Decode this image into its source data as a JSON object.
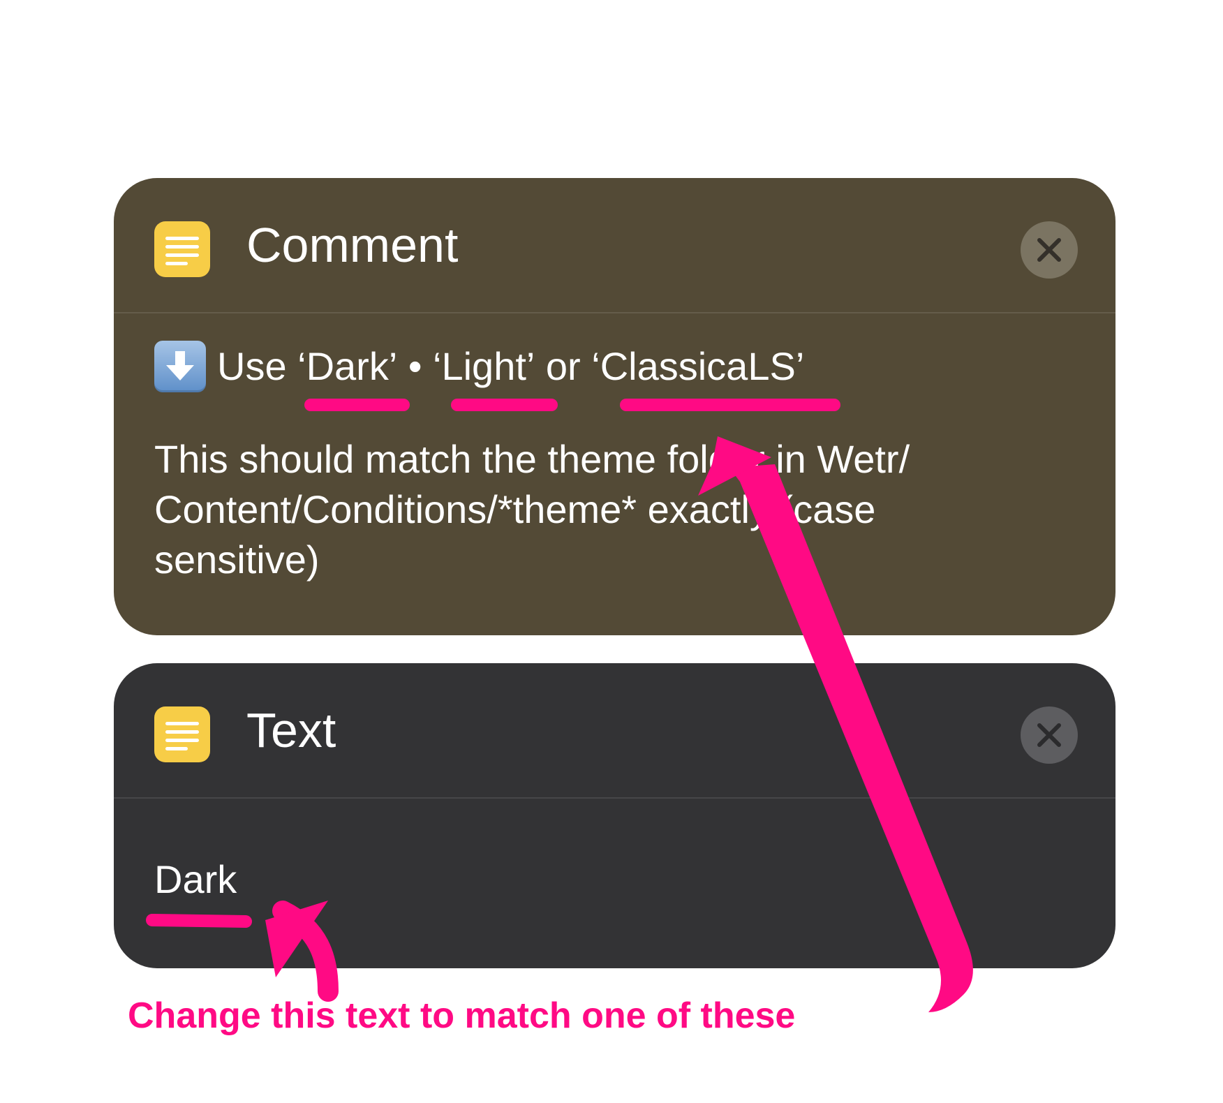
{
  "comment_card": {
    "title": "Comment",
    "line1": {
      "prefix": "Use ",
      "option_dark": "‘Dark’",
      "bullet": " • ",
      "option_light": "‘Light’",
      "or_text": " or ",
      "option_classic": "‘ClassicaLS’"
    },
    "description": "This should match the theme folder in Wetr/ Content/Conditions/*theme* exactly (case sensitive)"
  },
  "text_card": {
    "title": "Text",
    "value": "Dark"
  },
  "annotation": {
    "label": "Change this text to match one of these",
    "color": "#ff0a84"
  },
  "colors": {
    "comment_card_bg": "#534a36",
    "text_card_bg": "#333335",
    "icon_yellow": "#f7cd47"
  },
  "icons": {
    "comment_icon": "text-lines-icon",
    "text_icon": "text-lines-icon",
    "emoji": "down-arrow-emoji-icon",
    "close": "close-icon"
  }
}
